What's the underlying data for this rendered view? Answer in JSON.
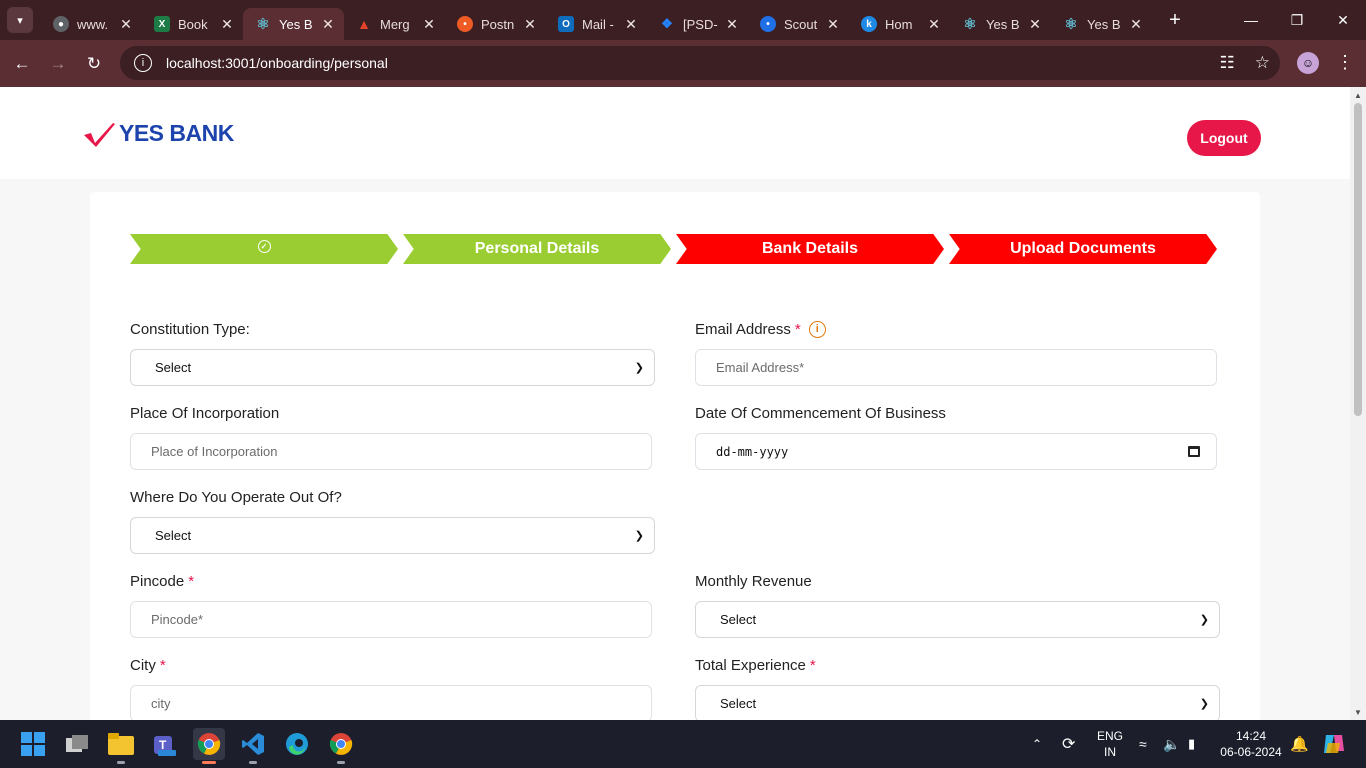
{
  "browser": {
    "tabs": [
      {
        "title": "www.",
        "active": false,
        "icon": "globe-icon",
        "color": "#5f6368"
      },
      {
        "title": "Book",
        "active": false,
        "icon": "excel-icon",
        "color": "#1d7b45"
      },
      {
        "title": "Yes B",
        "active": true,
        "icon": "react-icon",
        "color": "#5fb3c7"
      },
      {
        "title": "Merg",
        "active": false,
        "icon": "gitlab-icon",
        "color": "#e24329"
      },
      {
        "title": "Postn",
        "active": false,
        "icon": "postman-icon",
        "color": "#ef5b25"
      },
      {
        "title": "Mail -",
        "active": false,
        "icon": "outlook-icon",
        "color": "#0f6cbd"
      },
      {
        "title": "[PSD-",
        "active": false,
        "icon": "jira-icon",
        "color": "#2684ff"
      },
      {
        "title": "Scout",
        "active": false,
        "icon": "scout-icon",
        "color": "#1f6fe6"
      },
      {
        "title": "Hom",
        "active": false,
        "icon": "k-icon",
        "color": "#1f8ae6"
      },
      {
        "title": "Yes B",
        "active": false,
        "icon": "react-icon",
        "color": "#5fb3c7"
      },
      {
        "title": "Yes B",
        "active": false,
        "icon": "react-icon",
        "color": "#5fb3c7"
      }
    ],
    "url": "localhost:3001/onboarding/personal"
  },
  "header": {
    "logo_text": "YES BANK",
    "logout_label": "Logout"
  },
  "steps": [
    {
      "label": "",
      "status": "done",
      "icon": "check-circle-icon"
    },
    {
      "label": "Personal Details",
      "status": "done"
    },
    {
      "label": "Bank Details",
      "status": "pending"
    },
    {
      "label": "Upload Documents",
      "status": "pending"
    }
  ],
  "form": {
    "constitution_type": {
      "label": "Constitution Type:",
      "value": "Select"
    },
    "email": {
      "label": "Email Address",
      "required": "*",
      "placeholder": "Email Address*"
    },
    "place_of_incorporation": {
      "label": "Place Of Incorporation",
      "placeholder": "Place of Incorporation"
    },
    "date_of_commencement": {
      "label": "Date Of Commencement Of Business",
      "placeholder": "dd-mm-yyyy"
    },
    "operate_out_of": {
      "label": "Where Do You Operate Out Of?",
      "value": "Select"
    },
    "pincode": {
      "label": "Pincode",
      "required": "*",
      "placeholder": "Pincode*"
    },
    "monthly_revenue": {
      "label": "Monthly Revenue",
      "value": "Select"
    },
    "city": {
      "label": "City",
      "required": "*",
      "placeholder": "city"
    },
    "total_experience": {
      "label": "Total Experience",
      "required": "*",
      "value": "Select"
    }
  },
  "taskbar": {
    "language": "ENG",
    "region": "IN",
    "time": "14:24",
    "date": "06-06-2024"
  },
  "colors": {
    "brand_red": "#e8174a",
    "brand_blue": "#1d43ad",
    "step_done": "#9acd32",
    "step_pending": "#ff0000"
  }
}
